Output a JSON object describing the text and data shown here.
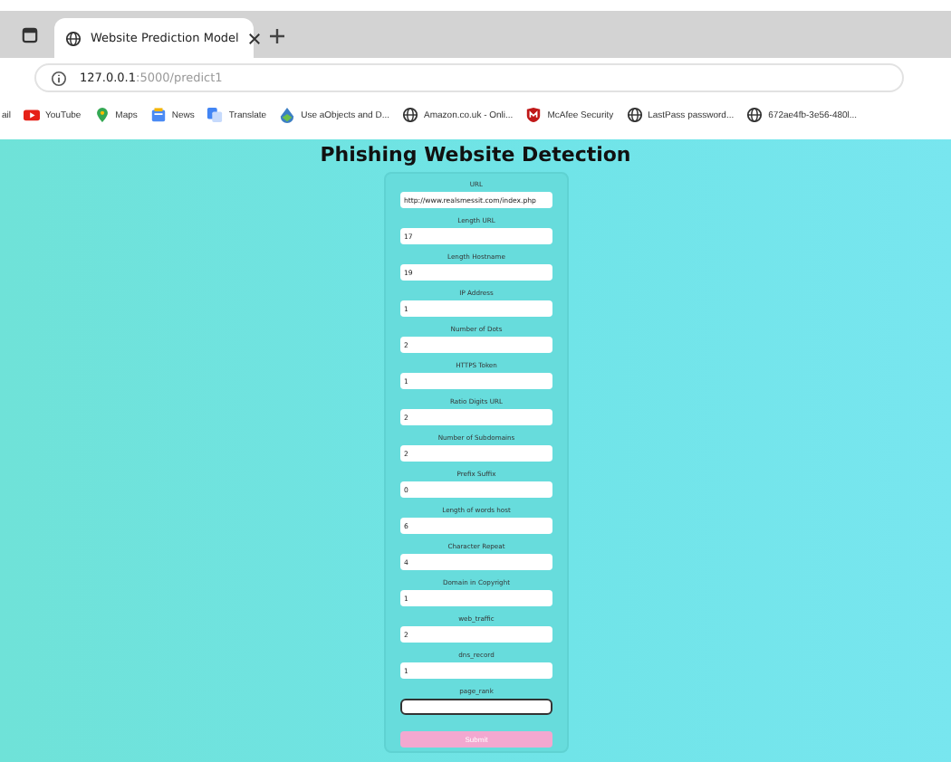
{
  "browser": {
    "tab": {
      "title": "Website Prediction Model",
      "selected": true
    },
    "address": {
      "host": "127.0.0.1",
      "path": ":5000/predict1"
    },
    "bookmarks": [
      {
        "label": "ail",
        "kind": "cut"
      },
      {
        "label": "YouTube",
        "kind": "youtube"
      },
      {
        "label": "Maps",
        "kind": "maps"
      },
      {
        "label": "News",
        "kind": "news"
      },
      {
        "label": "Translate",
        "kind": "translate"
      },
      {
        "label": "Use aObjects and D...",
        "kind": "drop"
      },
      {
        "label": "Amazon.co.uk - Onli...",
        "kind": "globe"
      },
      {
        "label": "McAfee Security",
        "kind": "shield"
      },
      {
        "label": "LastPass password...",
        "kind": "globe"
      },
      {
        "label": "672ae4fb-3e56-480l...",
        "kind": "globe"
      }
    ]
  },
  "page": {
    "title": "Phishing Website Detection",
    "fields": [
      {
        "label": "URL",
        "value": "http://www.realsmessit.com/index.php",
        "focused": false
      },
      {
        "label": "Length URL",
        "value": "17",
        "focused": false
      },
      {
        "label": "Length Hostname",
        "value": "19",
        "focused": false
      },
      {
        "label": "IP Address",
        "value": "1",
        "focused": false
      },
      {
        "label": "Number of Dots",
        "value": "2",
        "focused": false
      },
      {
        "label": "HTTPS Token",
        "value": "1",
        "focused": false
      },
      {
        "label": "Ratio Digits URL",
        "value": "2",
        "focused": false
      },
      {
        "label": "Number of Subdomains",
        "value": "2",
        "focused": false
      },
      {
        "label": "Prefix Suffix",
        "value": "0",
        "focused": false
      },
      {
        "label": "Length of words host",
        "value": "6",
        "focused": false
      },
      {
        "label": "Character Repeat",
        "value": "4",
        "focused": false
      },
      {
        "label": "Domain in Copyright",
        "value": "1",
        "focused": false
      },
      {
        "label": "web_traffic",
        "value": "2",
        "focused": false
      },
      {
        "label": "dns_record",
        "value": "1",
        "focused": false
      },
      {
        "label": "page_rank",
        "focused": true
      }
    ],
    "submit": "Submit"
  }
}
